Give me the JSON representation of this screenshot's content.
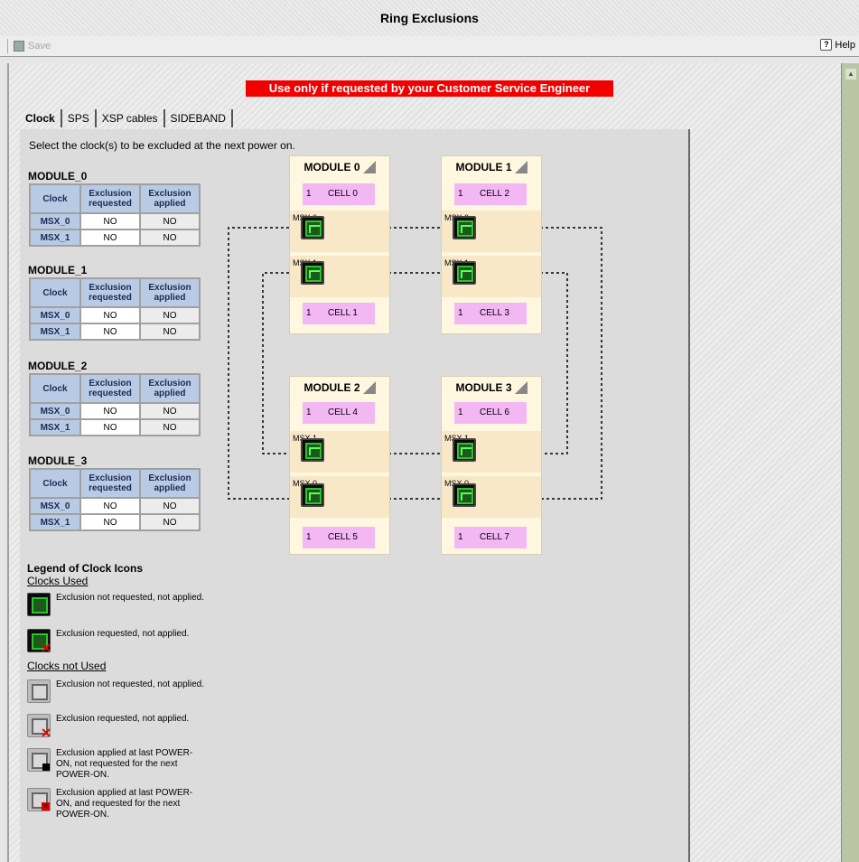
{
  "window": {
    "title": "Ring Exclusions"
  },
  "toolbar": {
    "save_label": "Save",
    "help_label": "Help"
  },
  "warning": "Use only if requested by your Customer Service Engineer",
  "tabs": [
    {
      "label": "Clock",
      "active": true
    },
    {
      "label": "SPS"
    },
    {
      "label": "XSP cables"
    },
    {
      "label": "SIDEBAND"
    }
  ],
  "instruction": "Select the clock(s) to be excluded at the next power on.",
  "table_headers": {
    "clock": "Clock",
    "requested": "Exclusion requested",
    "applied": "Exclusion applied"
  },
  "modules": [
    {
      "name": "MODULE_0",
      "rows": [
        {
          "clock": "MSX_0",
          "requested": "NO",
          "applied": "NO"
        },
        {
          "clock": "MSX_1",
          "requested": "NO",
          "applied": "NO"
        }
      ]
    },
    {
      "name": "MODULE_1",
      "rows": [
        {
          "clock": "MSX_0",
          "requested": "NO",
          "applied": "NO"
        },
        {
          "clock": "MSX_1",
          "requested": "NO",
          "applied": "NO"
        }
      ]
    },
    {
      "name": "MODULE_2",
      "rows": [
        {
          "clock": "MSX_0",
          "requested": "NO",
          "applied": "NO"
        },
        {
          "clock": "MSX_1",
          "requested": "NO",
          "applied": "NO"
        }
      ]
    },
    {
      "name": "MODULE_3",
      "rows": [
        {
          "clock": "MSX_0",
          "requested": "NO",
          "applied": "NO"
        },
        {
          "clock": "MSX_1",
          "requested": "NO",
          "applied": "NO"
        }
      ]
    }
  ],
  "diagram": {
    "modules": [
      {
        "title": "MODULE 0",
        "cell_top": {
          "num": "1",
          "name": "CELL 0"
        },
        "msx_top": "MSX 0",
        "msx_bottom": "MSX 1",
        "cell_bottom": {
          "num": "1",
          "name": "CELL 1"
        }
      },
      {
        "title": "MODULE 1",
        "cell_top": {
          "num": "1",
          "name": "CELL 2"
        },
        "msx_top": "MSX 0",
        "msx_bottom": "MSX 1",
        "cell_bottom": {
          "num": "1",
          "name": "CELL 3"
        }
      },
      {
        "title": "MODULE 2",
        "cell_top": {
          "num": "1",
          "name": "CELL 4"
        },
        "msx_top": "MSX 1",
        "msx_bottom": "MSX 0",
        "cell_bottom": {
          "num": "1",
          "name": "CELL 5"
        }
      },
      {
        "title": "MODULE 3",
        "cell_top": {
          "num": "1",
          "name": "CELL 6"
        },
        "msx_top": "MSX 1",
        "msx_bottom": "MSX 0",
        "cell_bottom": {
          "num": "1",
          "name": "CELL 7"
        }
      }
    ]
  },
  "legend": {
    "title": "Legend of Clock Icons",
    "clocks_used": "Clocks Used",
    "clocks_not_used": "Clocks not Used",
    "items": [
      {
        "icon": "clock-green-icon",
        "text": "Exclusion not requested, not applied."
      },
      {
        "icon": "clock-green-excluded-icon",
        "text": "Exclusion requested, not applied."
      },
      {
        "icon": "clock-gray-icon",
        "text": "Exclusion not requested, not applied."
      },
      {
        "icon": "clock-gray-excluded-icon",
        "text": "Exclusion requested, not applied."
      },
      {
        "icon": "clock-gray-applied-icon",
        "text": "Exclusion applied at last POWER-ON, not requested for the next POWER-ON."
      },
      {
        "icon": "clock-gray-applied-requested-icon",
        "text": "Exclusion applied at last POWER-ON, and requested for the next POWER-ON."
      }
    ]
  },
  "colors": {
    "warning": "#f20000",
    "cell": "#f3b7f3",
    "module_bg": "#fff7df",
    "msx_band": "#f8e8c8",
    "header_blue": "#b9cbe4",
    "clock_green": "#2fc22f"
  }
}
